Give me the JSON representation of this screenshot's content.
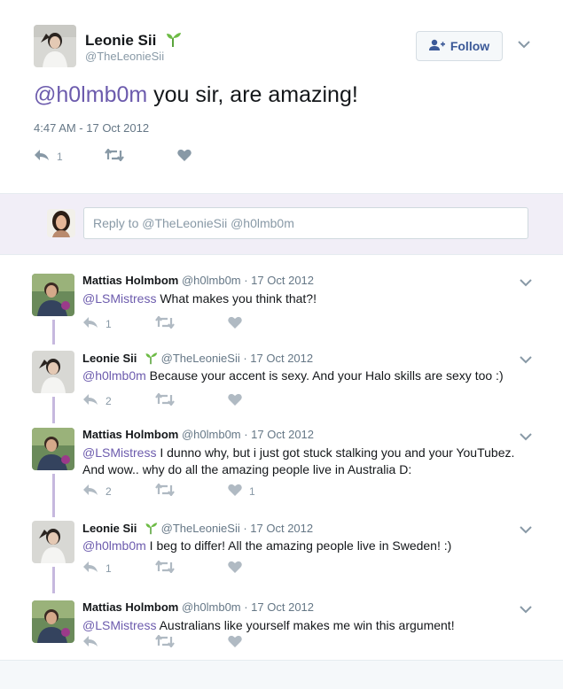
{
  "tweet": {
    "author_name": "Leonie Sii",
    "author_handle": "@TheLeonieSii",
    "follow_label": "Follow",
    "text_mention": "@h0lmb0m",
    "text_rest": " you sir, are amazing!",
    "timestamp": "4:47 AM - 17 Oct 2012",
    "reply_count": "1"
  },
  "reply_box": {
    "placeholder": "Reply to @TheLeonieSii @h0lmb0m"
  },
  "replies": [
    {
      "name": "Mattias Holmbom",
      "meta": "@h0lmb0m · 17 Oct 2012",
      "mention": "@LSMistress",
      "text": " What makes you think that?!",
      "reply_count": "1",
      "like_count": ""
    },
    {
      "name": "Leonie Sii",
      "meta": "@TheLeonieSii · 17 Oct 2012",
      "mention": "@h0lmb0m",
      "text": " Because your accent is sexy. And your Halo skills are sexy too :)",
      "reply_count": "2",
      "like_count": ""
    },
    {
      "name": "Mattias Holmbom",
      "meta": "@h0lmb0m · 17 Oct 2012",
      "mention": "@LSMistress",
      "text": " I dunno why, but i just got stuck stalking you and your YouTubez. And wow.. why do all the amazing people live in Australia D:",
      "reply_count": "2",
      "like_count": "1"
    },
    {
      "name": "Leonie Sii",
      "meta": "@TheLeonieSii · 17 Oct 2012",
      "mention": "@h0lmb0m",
      "text": " I beg to differ! All the amazing people live in Sweden! :)",
      "reply_count": "1",
      "like_count": ""
    },
    {
      "name": "Mattias Holmbom",
      "meta": "@h0lmb0m · 17 Oct 2012",
      "mention": "@LSMistress",
      "text": " Australians like yourself makes me win this argument!",
      "reply_count": "",
      "like_count": ""
    }
  ],
  "icons": {
    "reply": "reply-icon",
    "retweet": "retweet-icon",
    "like": "heart-icon",
    "more": "chevron-down-icon",
    "follow": "add-user-icon",
    "verified_like": "sprout-icon"
  },
  "colors": {
    "mention": "#6c5bad",
    "reply_bar_bg": "#f1eef7",
    "thread_line": "#c6b8de",
    "icon_gray": "#8899a6"
  }
}
